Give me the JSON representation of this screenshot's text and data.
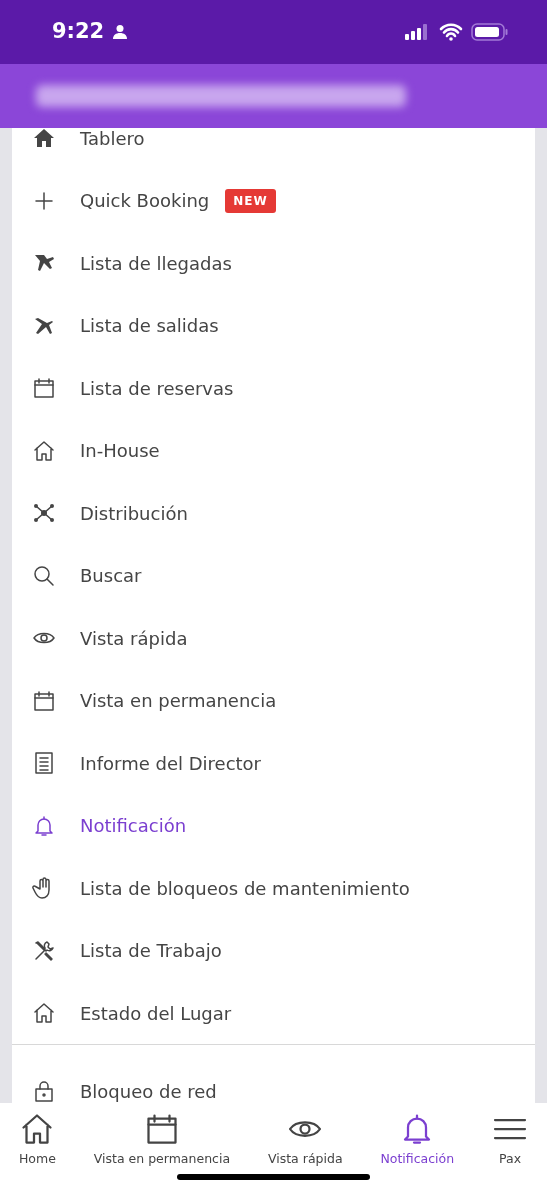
{
  "status_bar": {
    "time": "9:22"
  },
  "menu": {
    "sections": [
      {
        "items": [
          {
            "label": "Tablero",
            "kind": "home-solid",
            "selected": false
          },
          {
            "label": "Quick Booking",
            "kind": "plus",
            "selected": false,
            "badge": "NEW"
          },
          {
            "label": "Lista de llegadas",
            "kind": "plane-land",
            "selected": false
          },
          {
            "label": "Lista de salidas",
            "kind": "plane-depart",
            "selected": false
          },
          {
            "label": "Lista de reservas",
            "kind": "calendar",
            "selected": false
          },
          {
            "label": "In-House",
            "kind": "house",
            "selected": false
          },
          {
            "label": "Distribución",
            "kind": "network",
            "selected": false
          },
          {
            "label": "Buscar",
            "kind": "search",
            "selected": false
          },
          {
            "label": "Vista rápida",
            "kind": "eye",
            "selected": false
          },
          {
            "label": "Vista en permanencia",
            "kind": "calendar",
            "selected": false
          },
          {
            "label": "Informe del Director",
            "kind": "report",
            "selected": false
          },
          {
            "label": "Notificación",
            "kind": "bell",
            "selected": true
          },
          {
            "label": "Lista de bloqueos de mantenimiento",
            "kind": "hand",
            "selected": false
          },
          {
            "label": "Lista de Trabajo",
            "kind": "tools",
            "selected": false
          },
          {
            "label": "Estado del Lugar",
            "kind": "house",
            "selected": false
          }
        ]
      },
      {
        "items": [
          {
            "label": "Bloqueo de red",
            "kind": "lock",
            "selected": false
          }
        ]
      }
    ]
  },
  "tab_bar": [
    {
      "label": "Home",
      "kind": "house",
      "selected": false
    },
    {
      "label": "Vista en permanencia",
      "kind": "calendar",
      "selected": false
    },
    {
      "label": "Vista rápida",
      "kind": "eye",
      "selected": false
    },
    {
      "label": "Notificación",
      "kind": "bell",
      "selected": true
    },
    {
      "label": "Pax",
      "kind": "menu",
      "selected": false
    }
  ]
}
